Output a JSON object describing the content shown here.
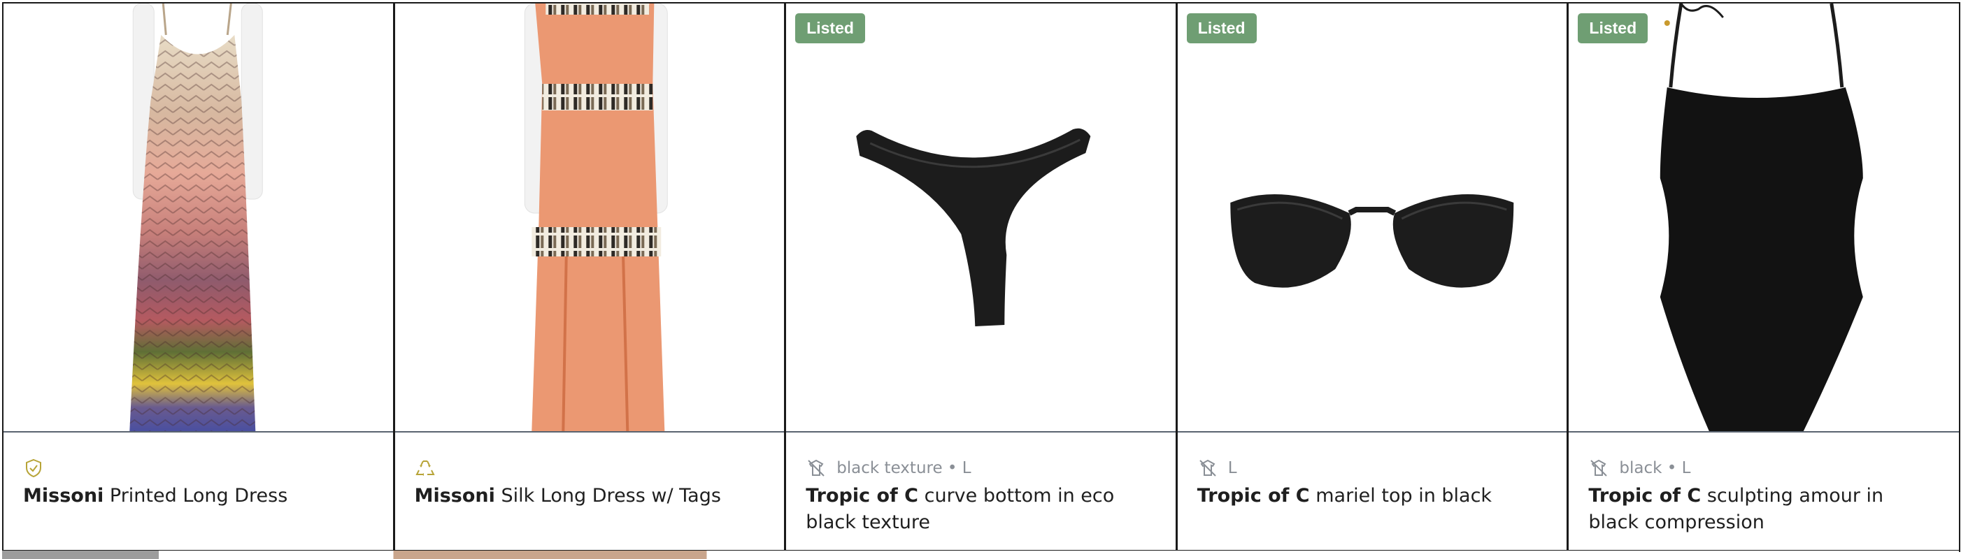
{
  "products": [
    {
      "brand": "Missoni",
      "name": "Printed Long Dress",
      "badge": "",
      "meta_icon": "shield-check-icon",
      "meta_text": ""
    },
    {
      "brand": "Missoni",
      "name": "Silk Long Dress w/ Tags",
      "badge": "",
      "meta_icon": "recycle-icon",
      "meta_text": ""
    },
    {
      "brand": "Tropic of C",
      "name": "curve bottom in eco black texture",
      "badge": "Listed",
      "meta_icon": "no-hanger-icon",
      "meta_text": "black texture • L"
    },
    {
      "brand": "Tropic of C",
      "name": "mariel top in black",
      "badge": "Listed",
      "meta_icon": "no-hanger-icon",
      "meta_text": "L"
    },
    {
      "brand": "Tropic of C",
      "name": "sculpting amour in black compression",
      "badge": "Listed",
      "meta_icon": "no-hanger-icon",
      "meta_text": "black • L"
    }
  ],
  "colors": {
    "listed_badge": "#6f9e73",
    "meta_text": "#8a8f96",
    "shield_icon": "#b7a437",
    "recycle_icon": "#b7a437"
  }
}
